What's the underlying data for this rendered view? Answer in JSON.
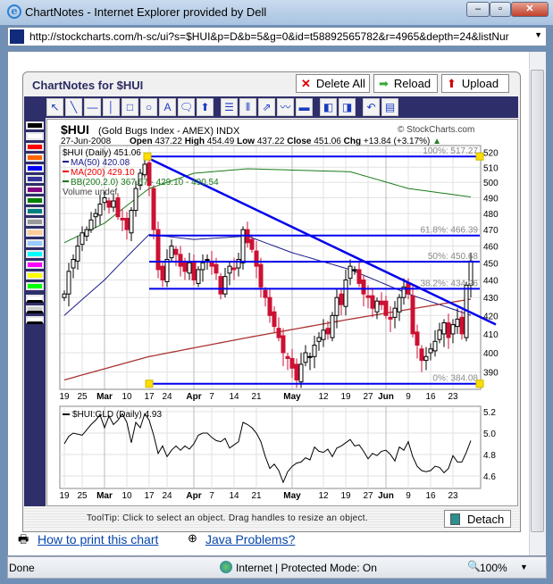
{
  "window": {
    "title": "ChartNotes - Internet Explorer provided by Dell",
    "url": "http://stockcharts.com/h-sc/ui?s=$HUI&p=D&b=5&g=0&id=t58892565782&r=4965&depth=24&listNur"
  },
  "applet": {
    "title": "ChartNotes for $HUI",
    "delete_all": "Delete All",
    "reload": "Reload",
    "upload": "Upload",
    "detach": "Detach",
    "tooltip": "ToolTip: Click to select an object. Drag handles to resize an object.",
    "tools": [
      "select-tool",
      "line-tool",
      "horizontal-line-tool",
      "vertical-line-tool",
      "rectangle-tool",
      "ellipse-tool",
      "text-tool",
      "callout-tool",
      "arrow-tool",
      "fibonacci-retracement-tool",
      "vertical-lines-tool",
      "parallel-lines-tool",
      "trendline-tool",
      "line-color-tool",
      "send-back-tool",
      "bring-forward-tool",
      "undo-tool",
      "properties-tool"
    ],
    "palette": [
      "#000000",
      "#ffffff",
      "#ff0000",
      "#ff6600",
      "#0000ff",
      "#333399",
      "#800080",
      "#008000",
      "#008080",
      "#999999",
      "#ffcc99",
      "#99ccff",
      "#00ffff",
      "#ff00ff",
      "#ffff00",
      "#00ff00"
    ]
  },
  "links": {
    "print": "How to print this chart",
    "java": "Java Problems?"
  },
  "status": {
    "text": "Done",
    "zone": "Internet | Protected Mode: On",
    "zoom": "100%"
  },
  "chart_data": [
    {
      "type": "candlestick",
      "title": "$HUI",
      "subtitle": "(Gold Bugs Index - AMEX) INDX",
      "date": "27-Jun-2008",
      "quote": {
        "open_label": "Open",
        "open": "437.22",
        "high_label": "High",
        "high": "454.49",
        "low_label": "Low",
        "low": "437.22",
        "close_label": "Close",
        "close": "451.06",
        "chg_label": "Chg",
        "chg": "+13.84 (+3.17%)"
      },
      "copyright": "© StockCharts.com",
      "legend": [
        "$HUI (Daily) 451.06",
        "MA(50) 420.08",
        "MA(200) 429.10",
        "BB(200,2.0) 367.67 - 429.10 - 490.54",
        "Volume undef"
      ],
      "y_scale": "log",
      "ylim": [
        380,
        522
      ],
      "y_ticks": [
        390,
        400,
        410,
        420,
        430,
        440,
        450,
        460,
        470,
        480,
        490,
        500,
        510,
        520
      ],
      "first_date": "2008-02-19",
      "holidays": [
        "2008-03-21",
        "2008-05-26"
      ],
      "x_ticks": [
        [
          "19",
          "2008-02-19"
        ],
        [
          "25",
          "2008-02-25"
        ],
        [
          "Mar",
          "2008-03-03"
        ],
        [
          "10",
          "2008-03-10"
        ],
        [
          "17",
          "2008-03-17"
        ],
        [
          "24",
          "2008-03-24"
        ],
        [
          "Apr",
          "2008-04-01"
        ],
        [
          "7",
          "2008-04-07"
        ],
        [
          "14",
          "2008-04-14"
        ],
        [
          "21",
          "2008-04-21"
        ],
        [
          "May",
          "2008-05-01"
        ],
        [
          "12",
          "2008-05-12"
        ],
        [
          "19",
          "2008-05-19"
        ],
        [
          "27",
          "2008-05-27"
        ],
        [
          "Jun",
          "2008-06-02"
        ],
        [
          "9",
          "2008-06-09"
        ],
        [
          "16",
          "2008-06-16"
        ],
        [
          "23",
          "2008-06-23"
        ]
      ],
      "close": [
        432,
        445,
        452,
        460,
        468,
        470,
        476,
        480,
        486,
        490,
        484,
        488,
        478,
        476,
        470,
        482,
        496,
        506,
        512,
        498,
        470,
        446,
        440,
        452,
        460,
        455,
        448,
        445,
        450,
        440,
        446,
        450,
        452,
        448,
        444,
        432,
        442,
        448,
        446,
        452,
        470,
        462,
        458,
        448,
        436,
        430,
        420,
        414,
        408,
        400,
        397,
        392,
        386,
        394,
        400,
        398,
        404,
        408,
        412,
        410,
        420,
        430,
        426,
        440,
        448,
        446,
        438,
        432,
        430,
        424,
        428,
        426,
        420,
        418,
        424,
        430,
        436,
        432,
        410,
        404,
        396,
        398,
        402,
        406,
        412,
        416,
        408,
        415,
        418,
        410,
        437,
        451.06
      ],
      "ma50": [
        [
          "2008-02-19",
          420
        ],
        [
          "2008-03-03",
          440
        ],
        [
          "2008-03-17",
          467
        ],
        [
          "2008-04-01",
          464
        ],
        [
          "2008-04-17",
          466
        ],
        [
          "2008-05-01",
          456
        ],
        [
          "2008-05-20",
          446
        ],
        [
          "2008-06-09",
          432
        ],
        [
          "2008-06-27",
          420.08
        ]
      ],
      "ma200": [
        [
          "2008-02-19",
          386
        ],
        [
          "2008-03-17",
          398
        ],
        [
          "2008-04-17",
          408
        ],
        [
          "2008-05-20",
          418
        ],
        [
          "2008-06-27",
          429.1
        ]
      ],
      "bb_upper": [
        [
          "2008-02-19",
          462
        ],
        [
          "2008-03-03",
          474
        ],
        [
          "2008-03-17",
          496
        ],
        [
          "2008-04-01",
          506
        ],
        [
          "2008-04-17",
          509
        ],
        [
          "2008-05-20",
          507
        ],
        [
          "2008-06-09",
          496
        ],
        [
          "2008-06-27",
          490.54
        ]
      ],
      "fib": [
        {
          "label": "100%: 517.27",
          "value": 517.27
        },
        {
          "label": "61.8%: 466.39",
          "value": 466.39
        },
        {
          "label": "50%: 450.68",
          "value": 450.68
        },
        {
          "label": "38.2%: 434.96",
          "value": 434.96
        },
        {
          "label": "0%: 384.08",
          "value": 384.08
        }
      ],
      "fib_start": "2008-03-17",
      "trendline": [
        [
          "2008-03-14",
          517.27
        ],
        [
          "2008-06-27",
          418
        ]
      ],
      "colors": {
        "up": "#ffffff",
        "down": "#cc1133",
        "ma50": "#1a1a8c",
        "ma200": "#a33",
        "bb": "#1a7a1a",
        "drawing": "#0000ee"
      }
    },
    {
      "type": "line",
      "legend": "$HUI:GLD (Daily) 4.93",
      "ylim": [
        4.5,
        5.25
      ],
      "y_ticks": [
        4.6,
        4.8,
        5.0,
        5.2
      ],
      "values": [
        4.9,
        4.97,
        5.0,
        4.99,
        4.98,
        5.03,
        5.08,
        5.12,
        5.17,
        5.05,
        5.16,
        5.08,
        5.12,
        5.18,
        5.1,
        4.91,
        5.1,
        5.05,
        5.18,
        5.12,
        4.98,
        4.81,
        4.88,
        4.78,
        4.84,
        4.88,
        4.84,
        4.88,
        4.85,
        4.9,
        4.98,
        5.0,
        5.0,
        4.96,
        4.93,
        4.92,
        4.95,
        4.86,
        4.89,
        4.92,
        5.1,
        5.08,
        5.05,
        5.0,
        4.92,
        4.78,
        4.67,
        4.71,
        4.65,
        4.54,
        4.64,
        4.69,
        4.72,
        4.73,
        4.77,
        4.75,
        4.87,
        4.83,
        4.82,
        4.85,
        4.78,
        4.86,
        4.88,
        4.91,
        4.94,
        4.88,
        4.89,
        4.83,
        4.76,
        4.81,
        4.79,
        4.83,
        4.84,
        4.8,
        4.74,
        4.87,
        4.84,
        4.92,
        4.78,
        4.69,
        4.65,
        4.64,
        4.65,
        4.69,
        4.68,
        4.63,
        4.67,
        4.79,
        4.73,
        4.73,
        4.82,
        4.93
      ]
    }
  ]
}
